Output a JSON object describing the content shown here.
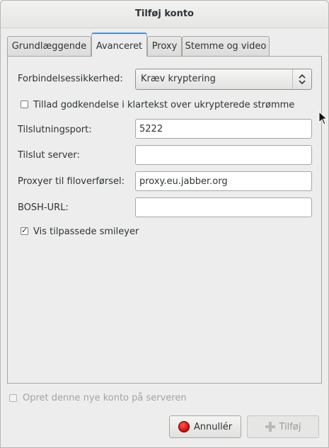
{
  "window": {
    "title": "Tilføj konto"
  },
  "tabs": [
    {
      "label": "Grundlæggende"
    },
    {
      "label": "Avanceret"
    },
    {
      "label": "Proxy"
    },
    {
      "label": "Stemme og video"
    }
  ],
  "advanced": {
    "security_label": "Forbindelsessikkerhed:",
    "security_value": "Kræv kryptering",
    "plaintext_auth_label": "Tillad godkendelse i klartekst over ukrypterede strømme",
    "plaintext_auth_checked": false,
    "port_label": "Tilslutningsport:",
    "port_value": "5222",
    "server_label": "Tilslut server:",
    "server_value": "",
    "file_proxy_label": "Proxyer til filoverførsel:",
    "file_proxy_value": "proxy.eu.jabber.org",
    "bosh_label": "BOSH-URL:",
    "bosh_value": "",
    "smileys_label": "Vis tilpassede smileyer",
    "smileys_checked": true
  },
  "footer": {
    "create_account_label": "Opret denne nye konto på serveren",
    "create_account_checked": false,
    "cancel_label": "Annullér",
    "add_label": "Tilføj"
  },
  "icons": {
    "cancel": "cancel-icon",
    "add": "plus-icon",
    "combo": "updown-arrows-icon",
    "cursor": "mouse-pointer-icon"
  },
  "colors": {
    "active_tab_accent": "#4a90d9",
    "cancel_icon": "#c80000"
  }
}
